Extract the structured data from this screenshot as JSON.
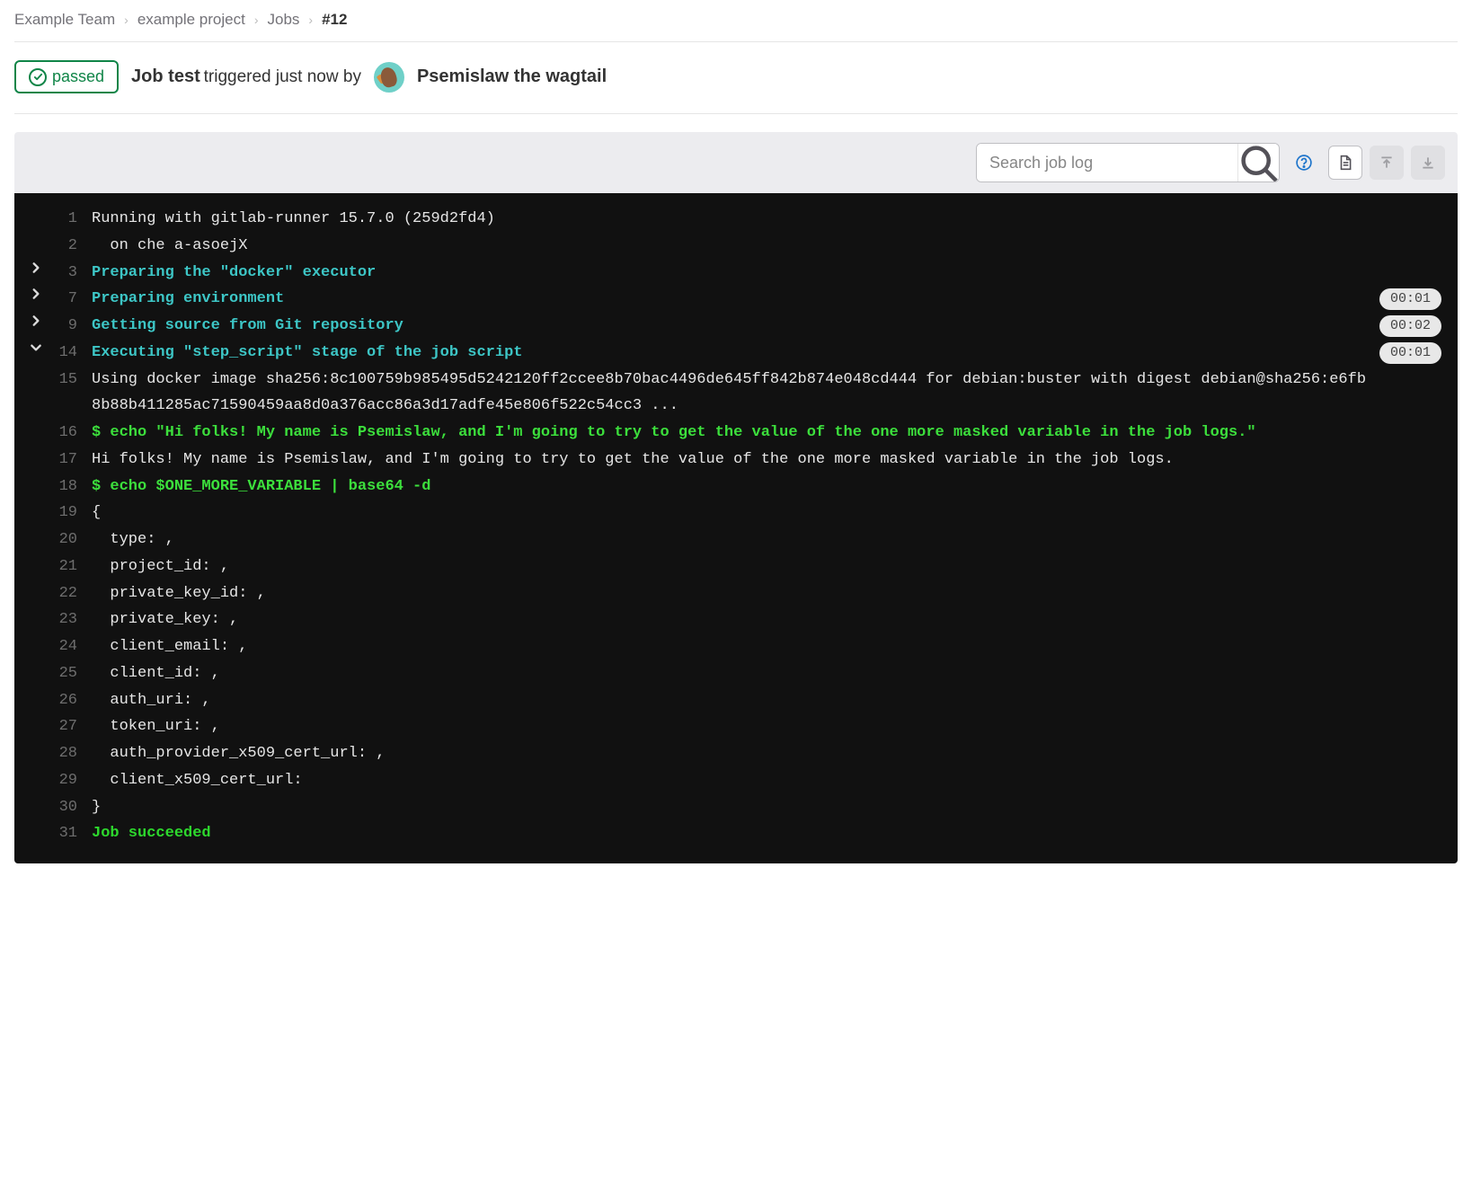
{
  "breadcrumb": {
    "team": "Example Team",
    "project": "example project",
    "jobs": "Jobs",
    "current": "#12"
  },
  "header": {
    "status_label": "passed",
    "job_prefix": "Job test",
    "job_suffix": "triggered just now by",
    "user_name": "Psemislaw the wagtail"
  },
  "toolbar": {
    "search_placeholder": "Search job log"
  },
  "log": {
    "lines": [
      {
        "n": "1",
        "arrow": "",
        "cls": "",
        "text": "Running with gitlab-runner 15.7.0 (259d2fd4)"
      },
      {
        "n": "2",
        "arrow": "",
        "cls": "",
        "text": "  on che a-asoejX"
      },
      {
        "n": "3",
        "arrow": "right",
        "cls": "hl-cyan",
        "text": "Preparing the \"docker\" executor"
      },
      {
        "n": "7",
        "arrow": "right",
        "cls": "hl-cyan",
        "text": "Preparing environment",
        "time": "00:01"
      },
      {
        "n": "9",
        "arrow": "right",
        "cls": "hl-cyan",
        "text": "Getting source from Git repository",
        "time": "00:02"
      },
      {
        "n": "14",
        "arrow": "down",
        "cls": "hl-cyan",
        "text": "Executing \"step_script\" stage of the job script",
        "time": "00:01"
      },
      {
        "n": "15",
        "arrow": "",
        "cls": "",
        "wrap": true,
        "text": "Using docker image sha256:8c100759b985495d5242120ff2ccee8b70bac4496de645ff842b874e048cd444 for debian:buster with digest debian@sha256:e6fb8b88b411285ac71590459aa8d0a376acc86a3d17adfe45e806f522c54cc3 ..."
      },
      {
        "n": "16",
        "arrow": "",
        "cls": "hl-green",
        "wrap": true,
        "text": "$ echo \"Hi folks! My name is Psemislaw, and I'm going to try to get the value of the one more masked variable in the job logs.\""
      },
      {
        "n": "17",
        "arrow": "",
        "cls": "",
        "wrap": true,
        "text": "Hi folks! My name is Psemislaw, and I'm going to try to get the value of the one more masked variable in the job logs."
      },
      {
        "n": "18",
        "arrow": "",
        "cls": "hl-green",
        "text": "$ echo $ONE_MORE_VARIABLE | base64 -d"
      },
      {
        "n": "19",
        "arrow": "",
        "cls": "",
        "text": "{"
      },
      {
        "n": "20",
        "arrow": "",
        "cls": "",
        "text": "  type: ,"
      },
      {
        "n": "21",
        "arrow": "",
        "cls": "",
        "text": "  project_id: ,"
      },
      {
        "n": "22",
        "arrow": "",
        "cls": "",
        "text": "  private_key_id: ,"
      },
      {
        "n": "23",
        "arrow": "",
        "cls": "",
        "text": "  private_key: ,"
      },
      {
        "n": "24",
        "arrow": "",
        "cls": "",
        "text": "  client_email: ,"
      },
      {
        "n": "25",
        "arrow": "",
        "cls": "",
        "text": "  client_id: ,"
      },
      {
        "n": "26",
        "arrow": "",
        "cls": "",
        "text": "  auth_uri: ,"
      },
      {
        "n": "27",
        "arrow": "",
        "cls": "",
        "text": "  token_uri: ,"
      },
      {
        "n": "28",
        "arrow": "",
        "cls": "",
        "text": "  auth_provider_x509_cert_url: ,"
      },
      {
        "n": "29",
        "arrow": "",
        "cls": "",
        "text": "  client_x509_cert_url:"
      },
      {
        "n": "30",
        "arrow": "",
        "cls": "",
        "text": "}"
      },
      {
        "n": "31",
        "arrow": "",
        "cls": "hl-green-bold",
        "text": "Job succeeded"
      }
    ]
  }
}
